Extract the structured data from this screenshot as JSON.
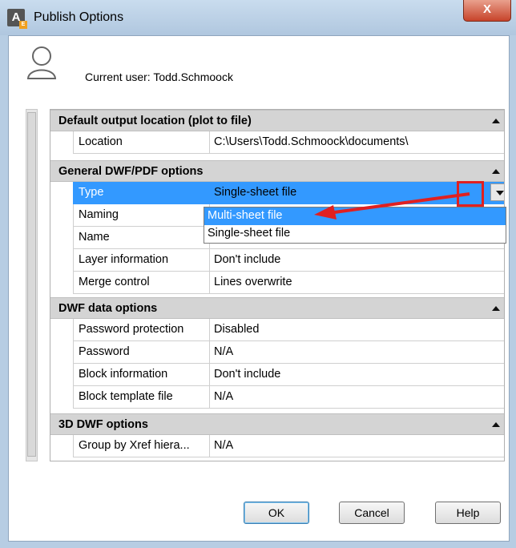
{
  "window": {
    "title": "Publish Options",
    "close_label": "X"
  },
  "user": {
    "label": "Current user: Todd.Schmoock"
  },
  "sections": {
    "output": {
      "header": "Default output location (plot to file)",
      "rows": [
        {
          "label": "Location",
          "value": "C:\\Users\\Todd.Schmoock\\documents\\"
        }
      ]
    },
    "dwfpdf": {
      "header": "General DWF/PDF options",
      "rows": [
        {
          "label": "Type",
          "value": "Single-sheet file"
        },
        {
          "label": "Naming",
          "value": ""
        },
        {
          "label": "Name",
          "value": ""
        },
        {
          "label": "Layer information",
          "value": "Don't include"
        },
        {
          "label": "Merge control",
          "value": "Lines overwrite"
        }
      ]
    },
    "dwfdata": {
      "header": "DWF data options",
      "rows": [
        {
          "label": "Password protection",
          "value": "Disabled"
        },
        {
          "label": "Password",
          "value": "N/A"
        },
        {
          "label": "Block information",
          "value": "Don't include"
        },
        {
          "label": "Block template file",
          "value": "N/A"
        }
      ]
    },
    "dwf3d": {
      "header": "3D DWF options",
      "rows": [
        {
          "label": "Group by Xref hiera...",
          "value": "N/A"
        }
      ]
    }
  },
  "dropdown": {
    "options": [
      "Multi-sheet file",
      "Single-sheet file"
    ]
  },
  "buttons": {
    "ok": "OK",
    "cancel": "Cancel",
    "help": "Help"
  },
  "colors": {
    "selection": "#3399ff",
    "annotation": "#e02020",
    "titlebar": "#b7cde3"
  }
}
